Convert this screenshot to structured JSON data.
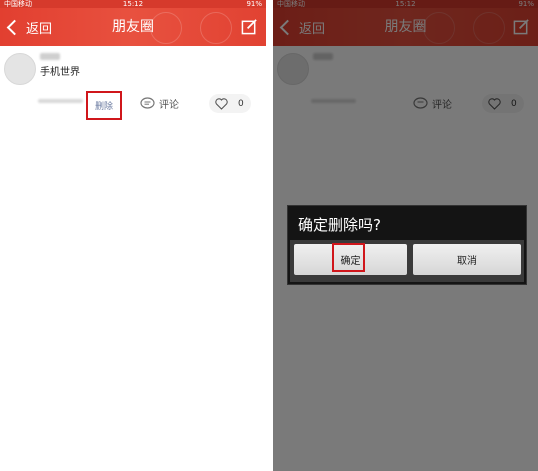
{
  "status_bar": {
    "carrier": "中国移动",
    "time": "15:12",
    "battery": "91%"
  },
  "navbar": {
    "back_label": "返回",
    "title": "朋友圈"
  },
  "post": {
    "text": "手机世界"
  },
  "actions": {
    "delete_label": "删除",
    "comment_label": "评论",
    "like_count": "0"
  },
  "dialog": {
    "title": "确定删除吗?",
    "confirm_label": "确定",
    "cancel_label": "取消"
  },
  "colors": {
    "nav_red": "#e23f30",
    "highlight": "#d0161b"
  }
}
